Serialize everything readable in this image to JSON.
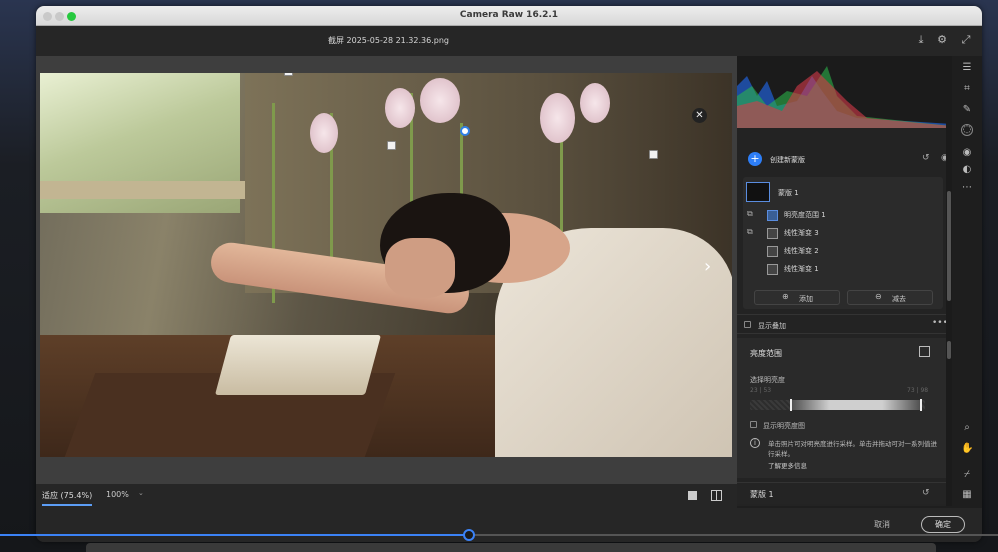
{
  "window": {
    "title": "Camera Raw 16.2.1"
  },
  "file": {
    "name": "截屏 2025-05-28 21.32.36.png"
  },
  "canvas": {
    "zoom_fit_label": "适应 (75.4%)",
    "zoom_value": "100%"
  },
  "masks": {
    "create_label": "创建新蒙版",
    "items": [
      {
        "label": "蒙版 1",
        "icon": "mask-thumbnail"
      },
      {
        "label": "明亮度范围 1",
        "icon": "luminance-range-icon"
      },
      {
        "label": "线性渐变 3",
        "icon": "linear-gradient-icon"
      },
      {
        "label": "线性渐变 2",
        "icon": "linear-gradient-icon"
      },
      {
        "label": "线性渐变 1",
        "icon": "linear-gradient-icon"
      }
    ],
    "add_label": "添加",
    "subtract_label": "减去",
    "show_overlay_label": "显示叠加"
  },
  "luminance": {
    "title": "亮度范围",
    "select_label": "选择明亮度",
    "range_min": "23 | 53",
    "range_max": "73 | 98",
    "range_low": 0.23,
    "range_high": 0.98,
    "show_map_label": "显示明亮度图",
    "info_text": "单击照片可对明亮度进行采样。单击并拖动可对一系列值进行采样。",
    "learn_more": "了解更多信息"
  },
  "mask_footer": {
    "label": "蒙版 1"
  },
  "footer": {
    "cancel": "取消",
    "ok": "确定"
  },
  "video": {
    "progress": 0.47
  }
}
